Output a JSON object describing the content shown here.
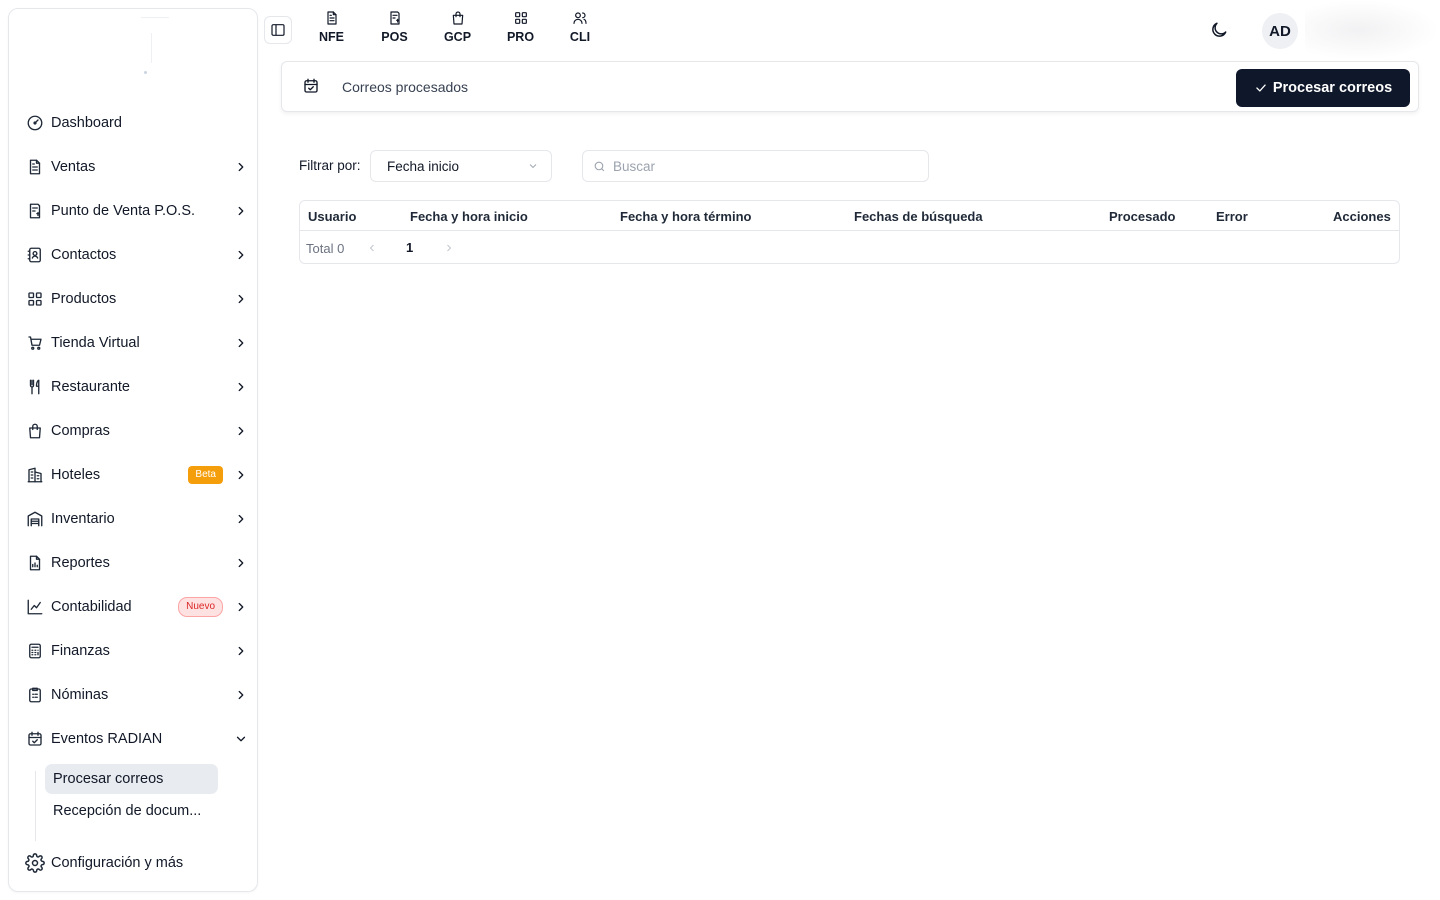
{
  "sidebar": {
    "items": [
      {
        "label": "Dashboard",
        "icon": "gauge-icon",
        "chevron": false
      },
      {
        "label": "Ventas",
        "icon": "document-icon",
        "chevron": true
      },
      {
        "label": "Punto de Venta P.O.S.",
        "icon": "receipt-icon",
        "chevron": true
      },
      {
        "label": "Contactos",
        "icon": "contact-book-icon",
        "chevron": true
      },
      {
        "label": "Productos",
        "icon": "grid-icon",
        "chevron": true
      },
      {
        "label": "Tienda Virtual",
        "icon": "cart-icon",
        "chevron": true
      },
      {
        "label": "Restaurante",
        "icon": "utensils-icon",
        "chevron": true
      },
      {
        "label": "Compras",
        "icon": "shopping-bag-icon",
        "chevron": true
      },
      {
        "label": "Hoteles",
        "icon": "building-icon",
        "chevron": true,
        "badge": "Beta"
      },
      {
        "label": "Inventario",
        "icon": "warehouse-icon",
        "chevron": true
      },
      {
        "label": "Reportes",
        "icon": "report-icon",
        "chevron": true
      },
      {
        "label": "Contabilidad",
        "icon": "line-chart-icon",
        "chevron": true,
        "badge": "Nuevo"
      },
      {
        "label": "Finanzas",
        "icon": "calculator-icon",
        "chevron": true
      },
      {
        "label": "Nóminas",
        "icon": "clipboard-icon",
        "chevron": true
      },
      {
        "label": "Eventos RADIAN",
        "icon": "calendar-check-icon",
        "chevron": true,
        "expanded": true
      }
    ],
    "subitems": [
      {
        "label": "Procesar correos",
        "active": true
      },
      {
        "label": "Recepción de docum..."
      }
    ],
    "config_label": "Configuración y más"
  },
  "topnav": {
    "items": [
      {
        "label": "NFE",
        "icon": "file-text-icon"
      },
      {
        "label": "POS",
        "icon": "receipt-dollar-icon"
      },
      {
        "label": "GCP",
        "icon": "shopping-bag-icon"
      },
      {
        "label": "PRO",
        "icon": "grid-icon"
      },
      {
        "label": "CLI",
        "icon": "users-icon"
      }
    ],
    "avatar": "AD"
  },
  "header": {
    "title": "Correos procesados",
    "button_label": "Procesar correos"
  },
  "filters": {
    "label": "Filtrar por:",
    "select_value": "Fecha inicio",
    "search_placeholder": "Buscar"
  },
  "table": {
    "columns": [
      "Usuario",
      "Fecha y hora inicio",
      "Fecha y hora término",
      "Fechas de búsqueda",
      "Procesado",
      "Error",
      "Acciones"
    ],
    "total": "Total 0",
    "page": "1"
  },
  "colors": {
    "primary": "#0f172a",
    "active_bg": "#e8ebf0",
    "beta_badge": "#f59e0b",
    "new_badge": "#dc2626"
  }
}
